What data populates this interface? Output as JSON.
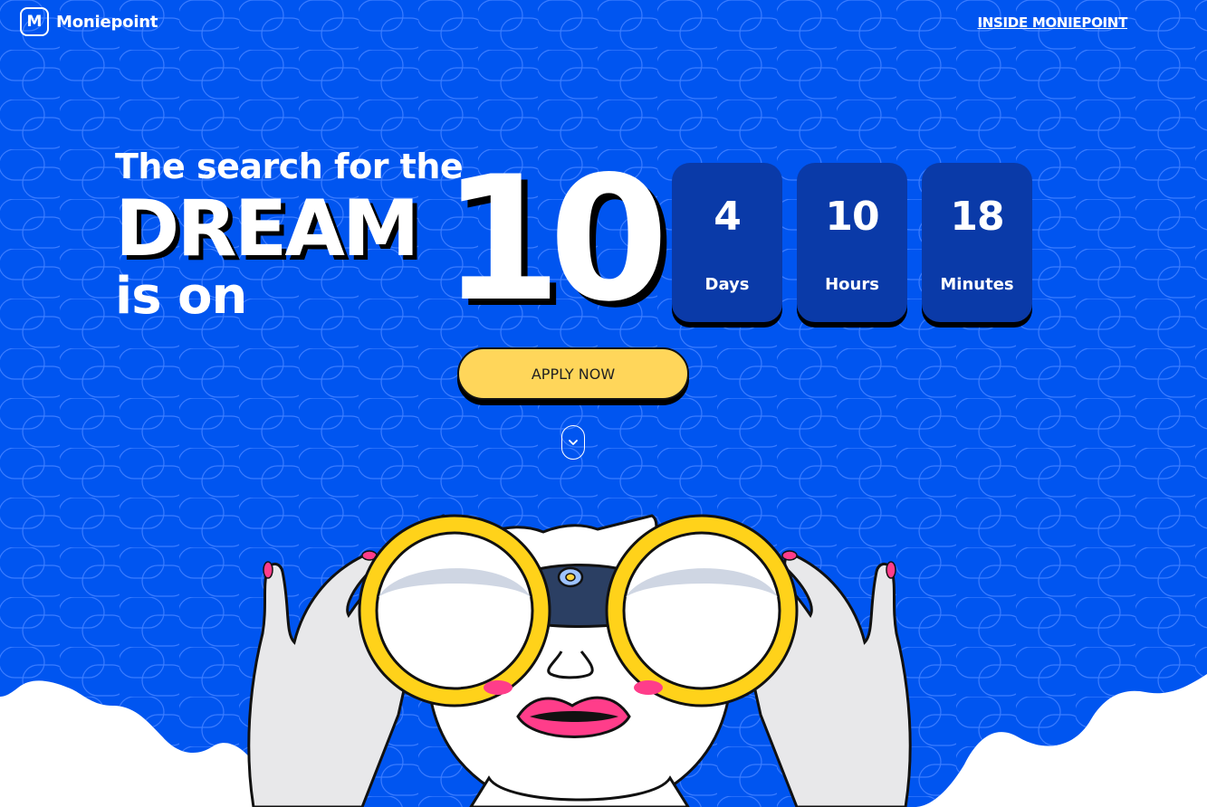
{
  "brand": {
    "logo_letter": "M",
    "name": "Moniepoint"
  },
  "nav": {
    "inside_link": "INSIDE MONIEPOINT"
  },
  "headline": {
    "line1": "The search for the",
    "line2": "DREAM",
    "line3": "is on",
    "big_number": "10"
  },
  "countdown": [
    {
      "value": "4",
      "label": "Days"
    },
    {
      "value": "10",
      "label": "Hours"
    },
    {
      "value": "18",
      "label": "Minutes"
    }
  ],
  "cta": {
    "apply_label": "APPLY NOW"
  },
  "colors": {
    "background_blue": "#0055f0",
    "countdown_box": "#0a3aa8",
    "button_yellow": "#ffd65a",
    "white": "#ffffff"
  },
  "icons": {
    "scroll": "chevron-down-icon"
  }
}
